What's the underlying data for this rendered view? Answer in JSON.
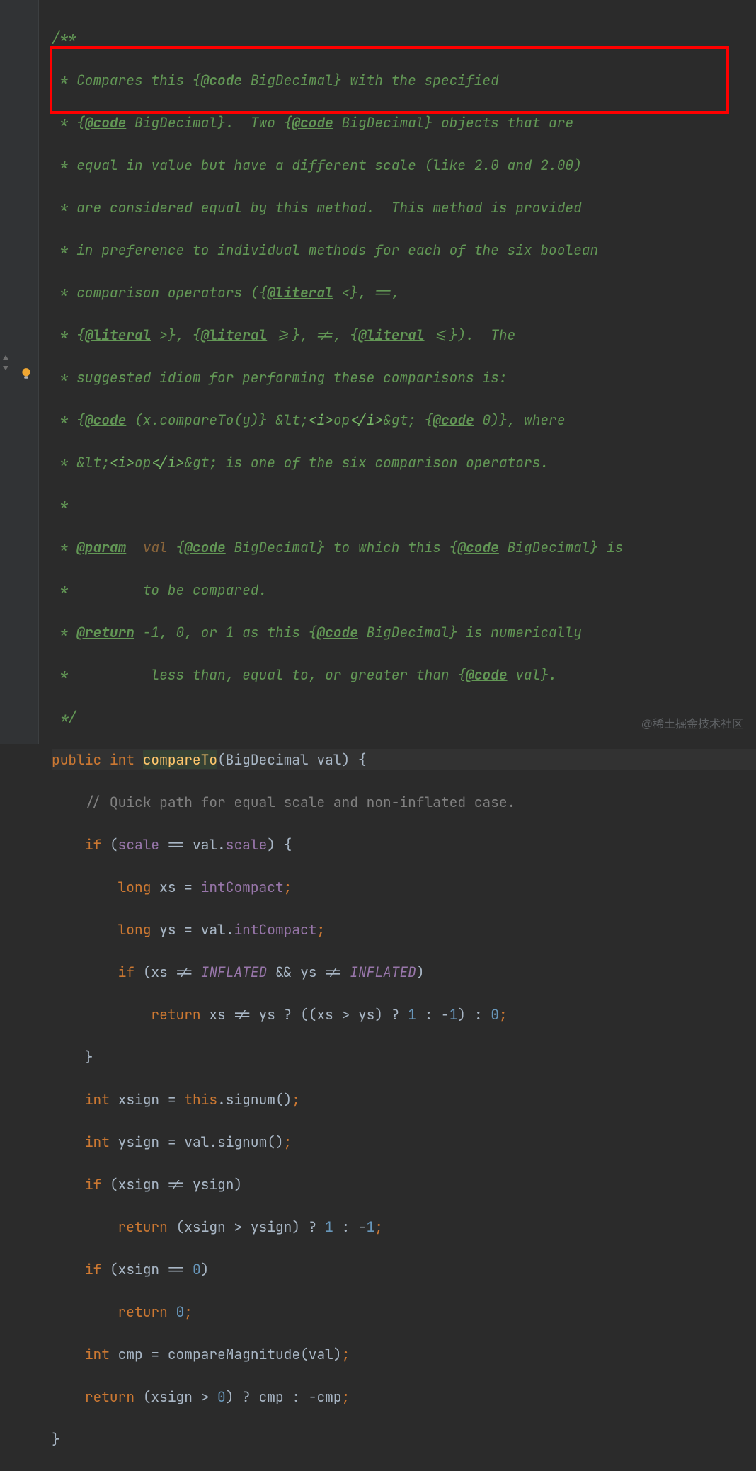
{
  "watermark": "@稀土掘金技术社区",
  "doc": {
    "l1": "/**",
    "l2_a": " * Compares this {",
    "l2_tag": "@code",
    "l2_b": " BigDecimal} with the specified",
    "l3_a": " * {",
    "l3_tag1": "@code",
    "l3_b": " BigDecimal}.  Two {",
    "l3_tag2": "@code",
    "l3_c": " BigDecimal} objects that are",
    "l4": " * equal in value but have a different scale (like 2.0 and 2.00)",
    "l5": " * are considered equal by this method.  This method is provided",
    "l6": " * in preference to individual methods for each of the six boolean",
    "l7_a": " * comparison operators ({",
    "l7_tag": "@literal",
    "l7_b": " <}, ==,",
    "l8_a": " * {",
    "l8_t1": "@literal",
    "l8_b": " >}, {",
    "l8_t2": "@literal",
    "l8_c": " >=}, !=, {",
    "l8_t3": "@literal",
    "l8_d": " <=}).  The",
    "l9": " * suggested idiom for performing these comparisons is:",
    "l10_a": " * {",
    "l10_t1": "@code",
    "l10_b": " (x.compareTo(y)} ",
    "l10_lt": "&lt;",
    "l10_i1": "<i>",
    "l10_op": "op",
    "l10_i2": "</i>",
    "l10_gt": "&gt;",
    "l10_c": " {",
    "l10_t2": "@code",
    "l10_d": " 0)}, where",
    "l11_a": " * ",
    "l11_lt": "&lt;",
    "l11_i1": "<i>",
    "l11_op": "op",
    "l11_i2": "</i>",
    "l11_gt": "&gt;",
    "l11_b": " is one of the six comparison operators.",
    "l12": " *",
    "l13_a": " * ",
    "l13_tag": "@param",
    "l13_b": "  ",
    "l13_name": "val",
    "l13_c": " {",
    "l13_t1": "@code",
    "l13_d": " BigDecimal} to which this {",
    "l13_t2": "@code",
    "l13_e": " BigDecimal} is",
    "l14": " *         to be compared.",
    "l15_a": " * ",
    "l15_tag": "@return",
    "l15_b": " -1, 0, or 1 as this {",
    "l15_t1": "@code",
    "l15_c": " BigDecimal} is numerically",
    "l16_a": " *          less than, equal to, or greater than {",
    "l16_t1": "@code",
    "l16_b": " val}.",
    "l17": " */"
  },
  "code": {
    "public": "public",
    "int": "int",
    "long": "long",
    "if": "if",
    "return": "return",
    "this": "this",
    "compareTo": "compareTo",
    "BigDecimal": "BigDecimal",
    "val": "val",
    "quick": "// Quick path for equal scale and non-inflated case.",
    "scale": "scale",
    "xs": "xs",
    "ys": "ys",
    "intCompact": "intCompact",
    "INFLATED": "INFLATED",
    "xsign": "xsign",
    "ysign": "ysign",
    "signum": "signum",
    "cmp": "cmp",
    "compareMagnitude": "compareMagnitude",
    "n1": "1",
    "nm1": "1",
    "n0": "0"
  }
}
